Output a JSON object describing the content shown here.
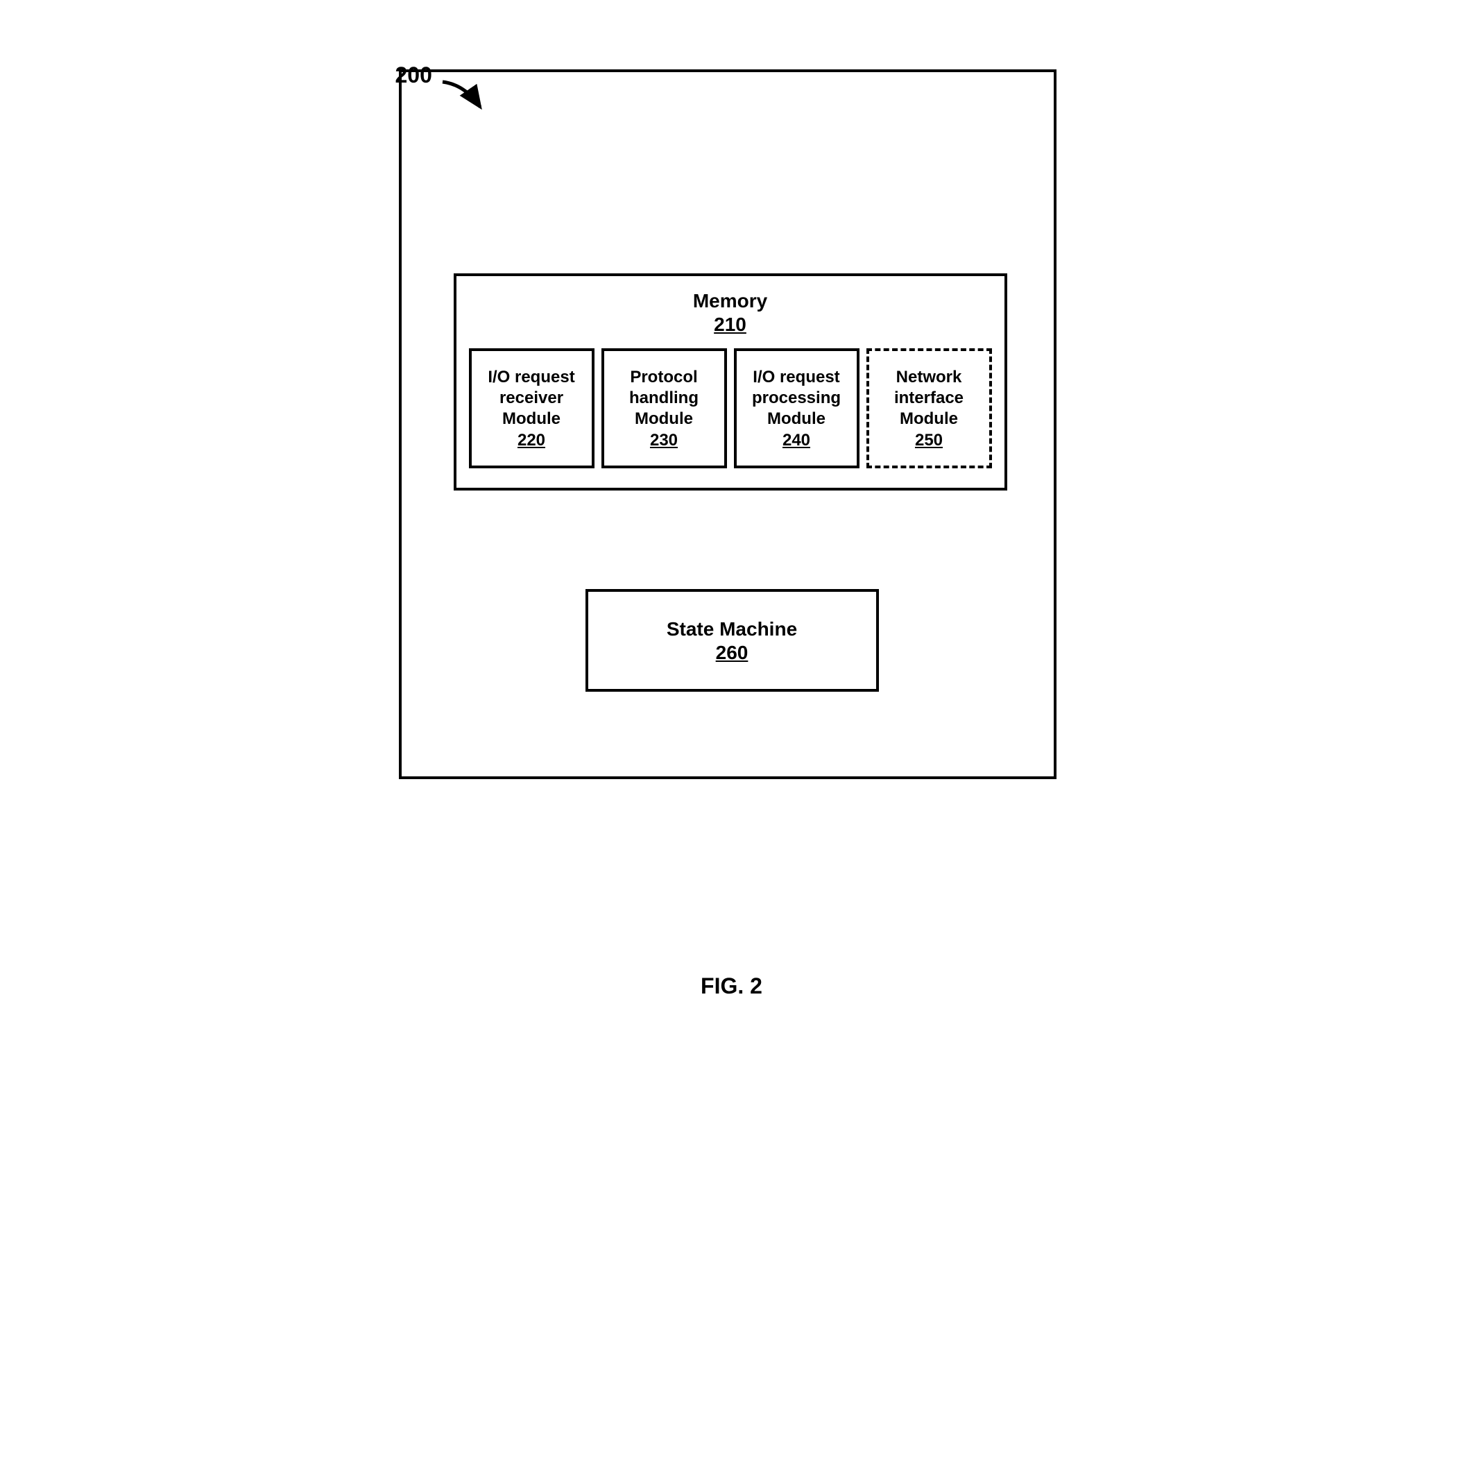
{
  "figure_ref": "200",
  "memory": {
    "title": "Memory",
    "ref": "210"
  },
  "modules": [
    {
      "line1": "I/O request",
      "line2": "receiver",
      "line3": "Module",
      "ref": "220",
      "dashed": false
    },
    {
      "line1": "Protocol",
      "line2": "handling",
      "line3": "Module",
      "ref": "230",
      "dashed": false
    },
    {
      "line1": "I/O request",
      "line2": "processing",
      "line3": "Module",
      "ref": "240",
      "dashed": false
    },
    {
      "line1": "Network",
      "line2": "interface",
      "line3": "Module",
      "ref": "250",
      "dashed": true
    }
  ],
  "state_machine": {
    "title": "State Machine",
    "ref": "260"
  },
  "caption": "FIG. 2"
}
